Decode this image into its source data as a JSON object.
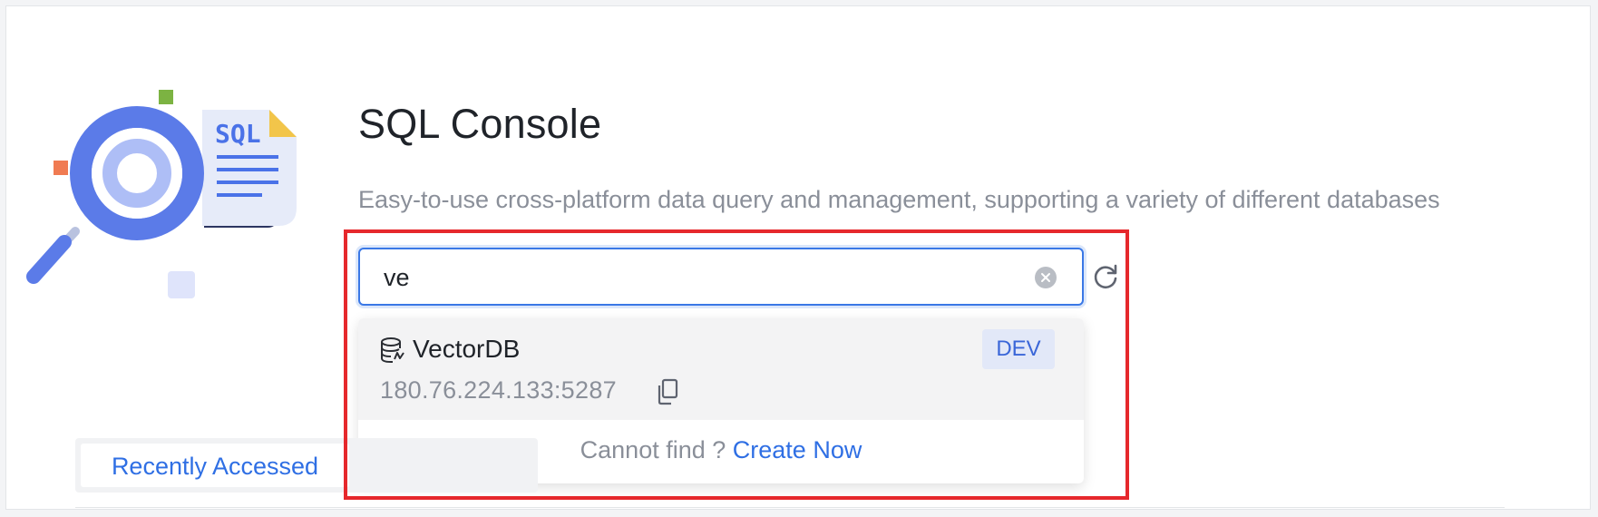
{
  "header": {
    "title": "SQL Console",
    "subtitle": "Easy-to-use cross-platform data query and management, supporting a variety of different databases"
  },
  "illustration": {
    "label": "SQL",
    "icon": "magnifier-document-illustration"
  },
  "search": {
    "value": "ve",
    "clear_icon": "clear-circle-icon",
    "refresh_icon": "refresh-icon"
  },
  "dropdown": {
    "options": [
      {
        "name": "VectorDB",
        "address": "180.76.224.133:5287",
        "env": "DEV",
        "icon": "database-icon",
        "copy_icon": "copy-icon"
      }
    ],
    "footer": {
      "text": "Cannot find ?",
      "link": "Create Now"
    }
  },
  "tabs": {
    "active": "Recently Accessed"
  },
  "colors": {
    "accent": "#2f6fe4",
    "highlight": "#e6282c",
    "tag_bg": "#e2e8f8",
    "muted_text": "#8a8f99"
  }
}
